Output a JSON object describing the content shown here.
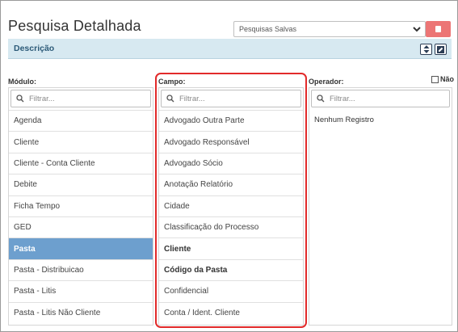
{
  "header": {
    "title": "Pesquisa Detalhada"
  },
  "saved_searches": {
    "selected": "Pesquisas Salvas"
  },
  "description": {
    "label": "Descrição"
  },
  "modulo": {
    "label": "Módulo:",
    "filter_placeholder": "Filtrar...",
    "items": [
      "Agenda",
      "Cliente",
      "Cliente - Conta Cliente",
      "Debite",
      "Ficha Tempo",
      "GED",
      "Pasta",
      "Pasta - Distribuicao",
      "Pasta - Litis",
      "Pasta - Litis Não Cliente"
    ],
    "selected": "Pasta"
  },
  "campo": {
    "label": "Campo:",
    "filter_placeholder": "Filtrar...",
    "items": [
      "Advogado Outra Parte",
      "Advogado Responsável",
      "Advogado Sócio",
      "Anotação Relatório",
      "Cidade",
      "Classificação do Processo",
      "Cliente",
      "Código da Pasta",
      "Confidencial",
      "Conta / Ident. Cliente"
    ],
    "bold_items": [
      "Cliente",
      "Código da Pasta"
    ]
  },
  "operador": {
    "label": "Operador:",
    "filter_placeholder": "Filtrar...",
    "items": [
      "Nenhum Registro"
    ]
  },
  "nao_checkbox": {
    "label": "Não",
    "checked": false
  },
  "colors": {
    "accent": "#6d9fce",
    "delete": "#ec7575",
    "highlight": "#e22a2a",
    "desc_bar": "#d7e9f1"
  }
}
